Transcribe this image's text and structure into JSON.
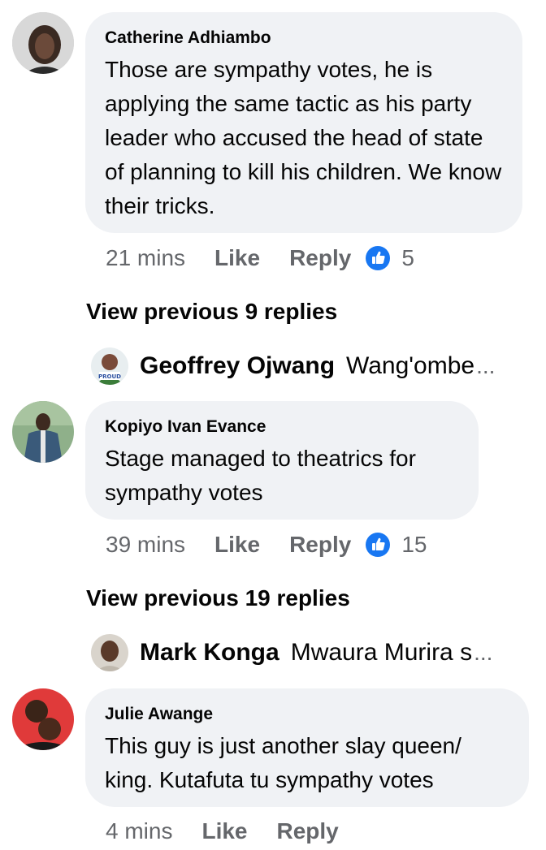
{
  "comments": [
    {
      "author": "Catherine Adhiambo",
      "text": "Those are sympathy votes, he is applying the same tactic as his party leader who accused the head of state of planning to kill his children. We know their tricks.",
      "time": "21 mins",
      "like_label": "Like",
      "reply_label": "Reply",
      "reaction_count": "5",
      "view_previous": "View previous 9 replies",
      "latest_reply": {
        "name": "Geoffrey Ojwang",
        "text": "Wang'ombe",
        "ellipsis": "..."
      }
    },
    {
      "author": "Kopiyo Ivan Evance",
      "text": "Stage managed to theatrics for sympathy votes",
      "time": "39 mins",
      "like_label": "Like",
      "reply_label": "Reply",
      "reaction_count": "15",
      "view_previous": "View previous 19 replies",
      "latest_reply": {
        "name": "Mark Konga",
        "text": "Mwaura Murira s",
        "ellipsis": "..."
      }
    },
    {
      "author": "Julie Awange",
      "text": "This guy is just another slay queen/ king. Kutafuta tu sympathy votes",
      "time": "4 mins",
      "like_label": "Like",
      "reply_label": "Reply"
    }
  ],
  "colors": {
    "bubble": "#f0f2f5",
    "meta": "#65676b",
    "like_blue": "#1877f2"
  },
  "icons": {
    "reaction": "like-thumb-icon",
    "avatar_badge_text": "PROUD"
  }
}
